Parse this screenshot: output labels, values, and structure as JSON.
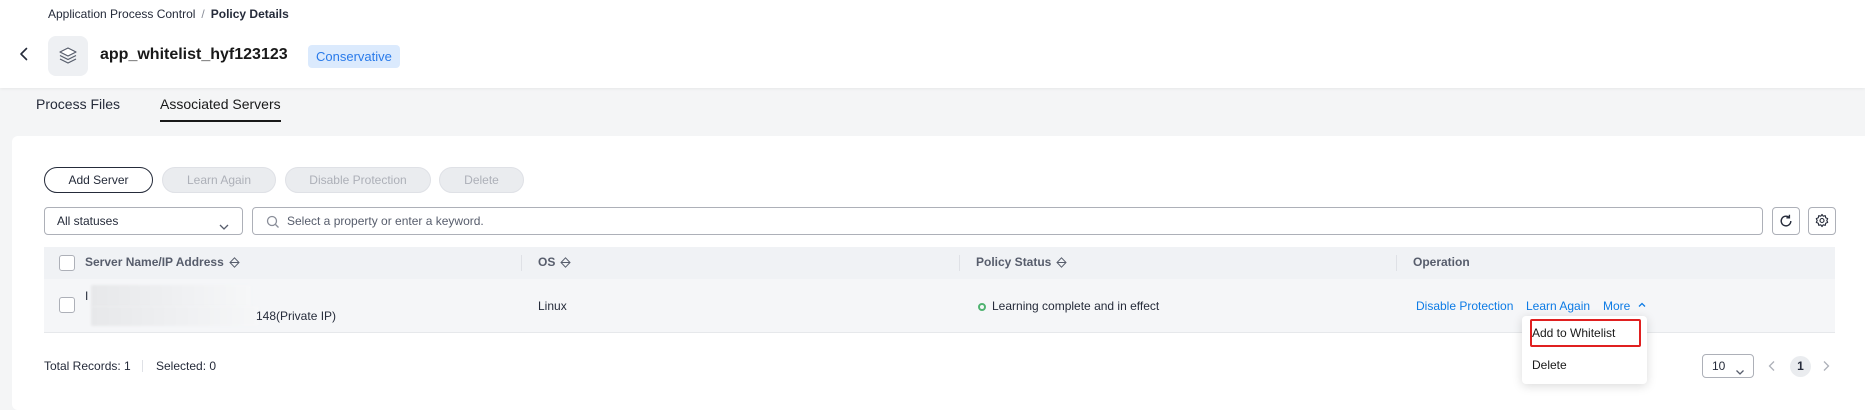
{
  "breadcrumb": {
    "parent": "Application Process Control",
    "separator": "/",
    "current": "Policy Details"
  },
  "policy": {
    "name": "app_whitelist_hyf123123",
    "level_tag": "Conservative"
  },
  "tabs": [
    {
      "label": "Process Files",
      "active": false
    },
    {
      "label": "Associated Servers",
      "active": true
    }
  ],
  "toolbar": {
    "add_server": "Add Server",
    "learn_again": "Learn Again",
    "disable_protection": "Disable Protection",
    "delete": "Delete"
  },
  "filter": {
    "status_value": "All statuses",
    "search_placeholder": "Select a property or enter a keyword."
  },
  "table": {
    "columns": [
      "Server Name/IP Address",
      "OS",
      "Policy Status",
      "Operation"
    ],
    "rows": [
      {
        "server_line1": "I",
        "server_line2": "148(Private IP)",
        "os": "Linux",
        "status": "Learning complete and in effect",
        "status_color": "#50b371",
        "ops": {
          "disable": "Disable Protection",
          "learn": "Learn Again",
          "more": "More"
        }
      }
    ]
  },
  "more_menu": {
    "items": [
      "Add to Whitelist",
      "Delete"
    ],
    "highlighted": "Add to Whitelist",
    "highlight_color": "#e02020"
  },
  "footer": {
    "total": "Total Records: 1",
    "selected": "Selected: 0"
  },
  "pagination": {
    "page_size": "10",
    "current_page": "1"
  },
  "colors": {
    "accent": "#0d7be5",
    "tag_bg": "#dbeafd",
    "tag_text": "#2a7bea"
  }
}
